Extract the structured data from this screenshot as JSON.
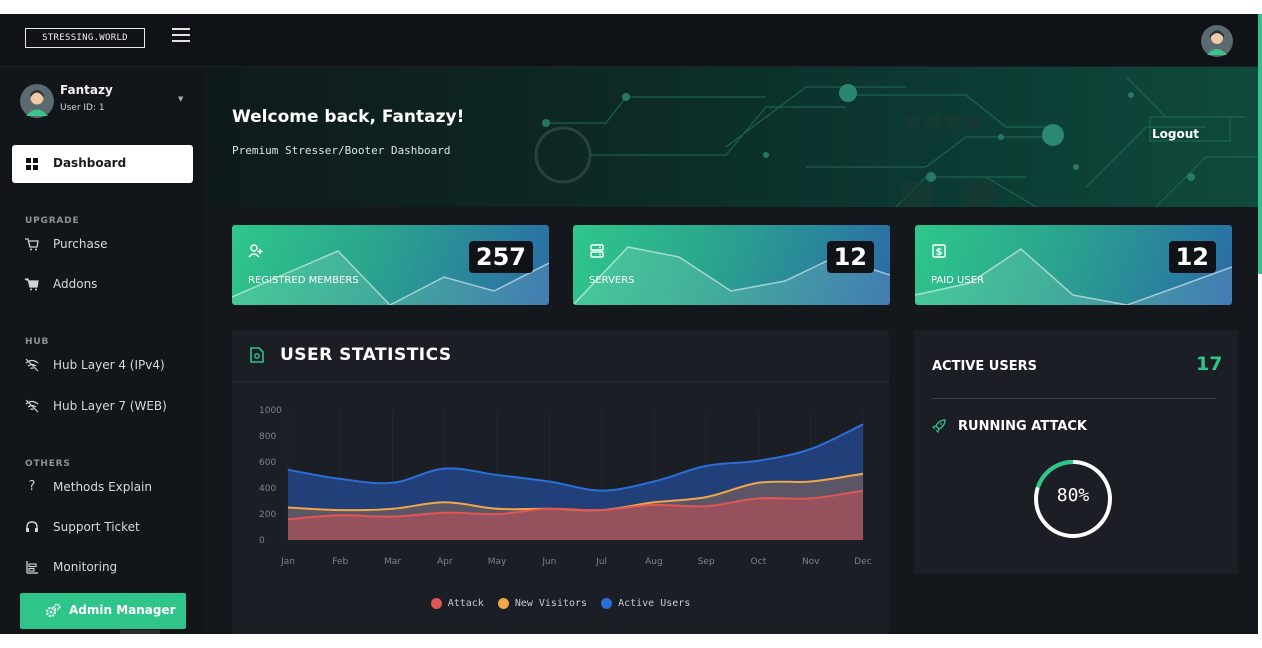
{
  "brand": "STRESSING.WORLD",
  "user": {
    "name": "Fantazy",
    "id_label": "User ID: 1"
  },
  "sidebar": {
    "active": {
      "label": "Dashboard"
    },
    "sections": {
      "upgrade": "UPGRADE",
      "hub": "HUB",
      "others": "OTHERS"
    },
    "upgrade_items": [
      {
        "label": "Purchase",
        "icon": "cart-icon"
      },
      {
        "label": "Addons",
        "icon": "cart-icon"
      }
    ],
    "hub_items": [
      {
        "label": "Hub Layer 4 (IPv4)",
        "icon": "wifi-off-icon"
      },
      {
        "label": "Hub Layer 7 (WEB)",
        "icon": "wifi-off-icon"
      }
    ],
    "others_items": [
      {
        "label": "Methods Explain",
        "icon": "question-icon"
      },
      {
        "label": "Support Ticket",
        "icon": "headset-icon"
      },
      {
        "label": "Monitoring",
        "icon": "monitor-icon"
      }
    ],
    "admin_button": "Admin Manager"
  },
  "banner": {
    "welcome": "Welcome back, Fantazy!",
    "subtitle": "Premium Stresser/Booter Dashboard",
    "logout": "Logout"
  },
  "stats": [
    {
      "label": "REGISTRED MEMBERS",
      "value": "257",
      "icon": "user-plus-icon"
    },
    {
      "label": "SERVERS",
      "value": "12",
      "icon": "server-icon"
    },
    {
      "label": "PAID USER",
      "value": "12",
      "icon": "dollar-icon"
    }
  ],
  "chart_title": "USER STATISTICS",
  "chart_data": {
    "type": "area",
    "categories": [
      "Jan",
      "Feb",
      "Mar",
      "Apr",
      "May",
      "Jun",
      "Jul",
      "Aug",
      "Sep",
      "Oct",
      "Nov",
      "Dec"
    ],
    "ylim": [
      0,
      1000
    ],
    "yticks": [
      0,
      200,
      400,
      600,
      800,
      1000
    ],
    "series": [
      {
        "name": "Active Users",
        "color": "#2a6fd6",
        "values": [
          540,
          470,
          440,
          550,
          500,
          450,
          380,
          450,
          570,
          610,
          700,
          890
        ]
      },
      {
        "name": "New Visitors",
        "color": "#f0a64a",
        "values": [
          250,
          230,
          240,
          290,
          240,
          240,
          230,
          290,
          330,
          440,
          450,
          510
        ]
      },
      {
        "name": "Attack",
        "color": "#e05656",
        "values": [
          160,
          190,
          180,
          210,
          200,
          240,
          230,
          270,
          260,
          320,
          320,
          380
        ]
      }
    ],
    "legend": [
      "Attack",
      "New Visitors",
      "Active Users"
    ],
    "legend_colors": [
      "#e05656",
      "#f0a64a",
      "#2a6fd6"
    ]
  },
  "right_panel": {
    "active_users_label": "ACTIVE USERS",
    "active_users_value": "17",
    "running_attack_label": "RUNNING ATTACK",
    "gauge_value": 80,
    "gauge_text": "80%"
  },
  "colors": {
    "accent": "#2ec48a",
    "background": "#14171c"
  }
}
